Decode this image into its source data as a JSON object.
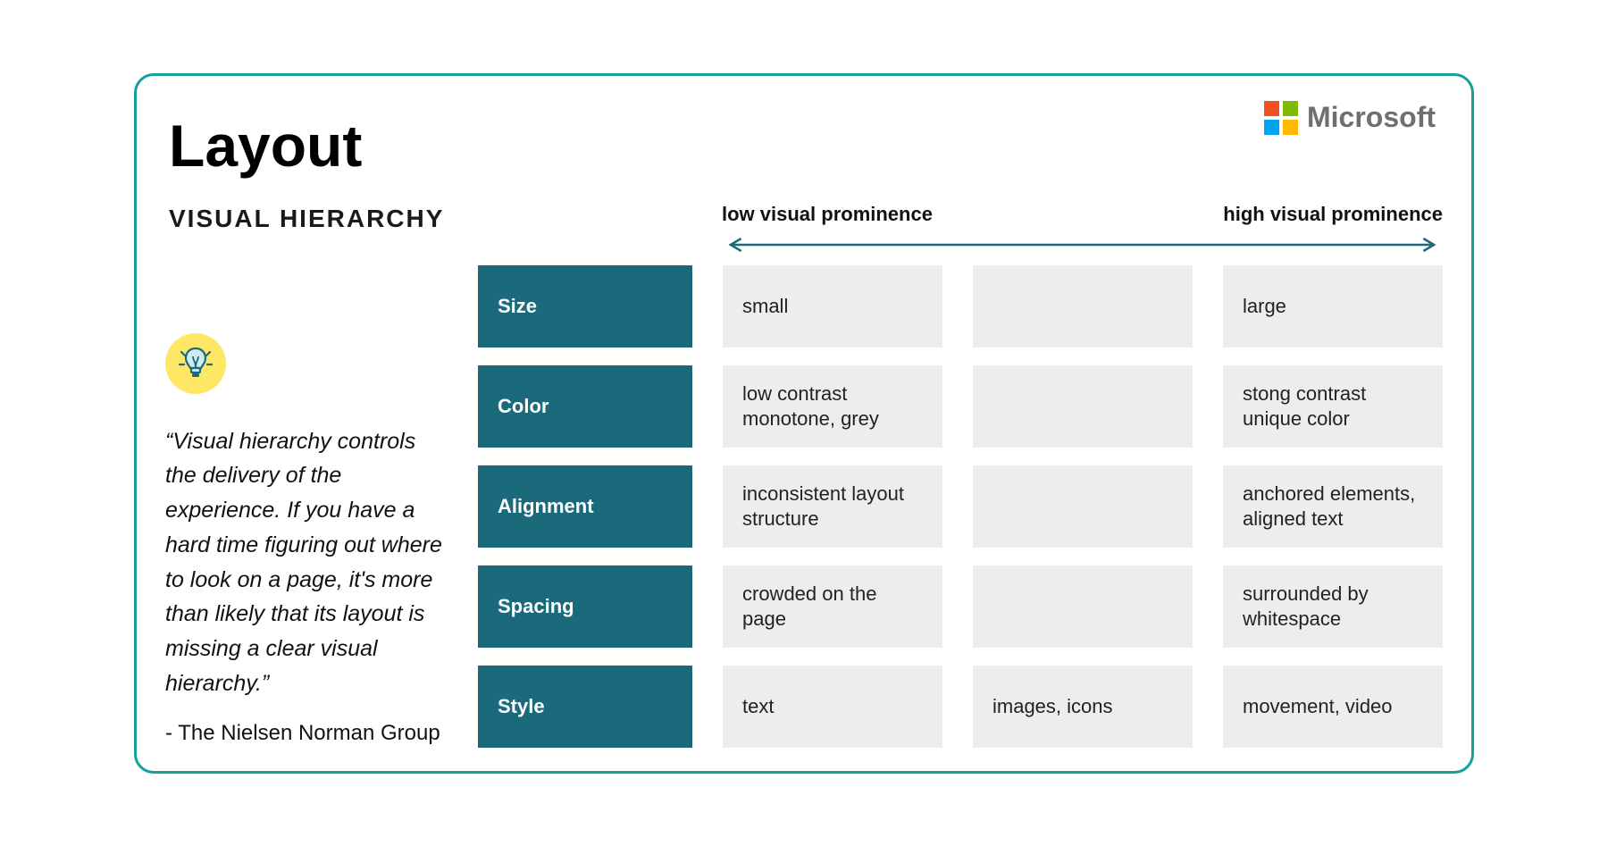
{
  "brand": {
    "name": "Microsoft"
  },
  "title": "Layout",
  "subtitle": "VISUAL HIERARCHY",
  "axis": {
    "low": "low visual prominence",
    "high": "high visual prominence"
  },
  "quote": "“Visual hierarchy controls the delivery of the experience. If you have a hard time figuring out where to look on a page, it's more than likely that its layout is missing a clear visual hierarchy.”",
  "attribution": "- The Nielsen Norman Group",
  "rows": [
    {
      "category": "Size",
      "low": "small",
      "mid": "",
      "high": "large"
    },
    {
      "category": "Color",
      "low": "low contrast\nmonotone, grey",
      "mid": "",
      "high": "stong contrast\nunique color"
    },
    {
      "category": "Alignment",
      "low": "inconsistent layout\nstructure",
      "mid": "",
      "high": "anchored elements,\naligned text"
    },
    {
      "category": "Spacing",
      "low": "crowded on the page",
      "mid": "",
      "high": "surrounded by\nwhitespace"
    },
    {
      "category": "Style",
      "low": "text",
      "mid": "images, icons",
      "high": "movement, video"
    }
  ],
  "colors": {
    "border": "#14a19a",
    "category_bg": "#1a6a7c",
    "value_bg": "#ededed",
    "ms_red": "#f25022",
    "ms_green": "#7fba00",
    "ms_blue": "#00a4ef",
    "ms_yellow": "#ffb900",
    "bulb_bg": "#ffe766"
  }
}
